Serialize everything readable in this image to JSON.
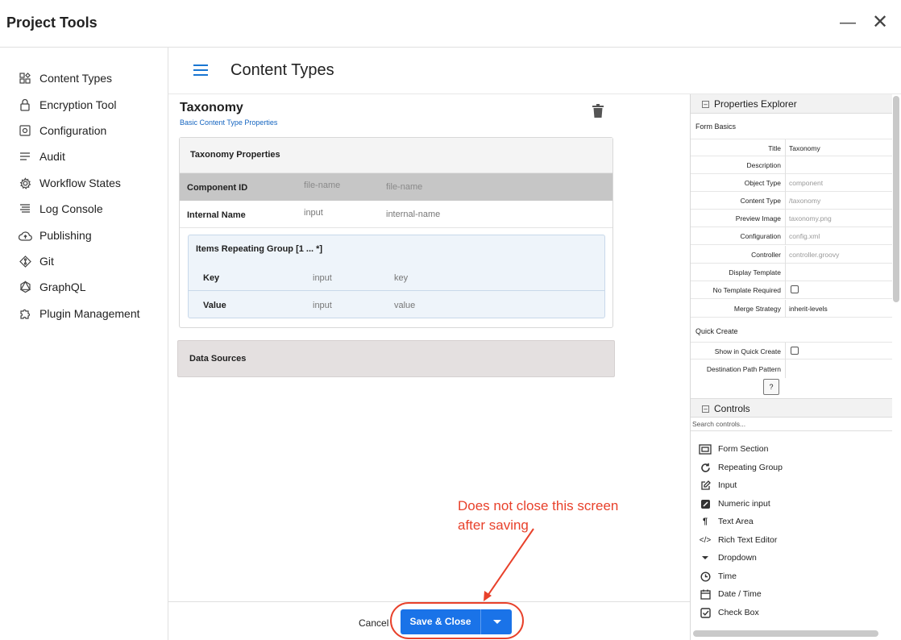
{
  "window": {
    "title": "Project Tools"
  },
  "sidebar": {
    "items": [
      {
        "label": "Content Types",
        "icon": "content-types-icon"
      },
      {
        "label": "Encryption Tool",
        "icon": "lock-icon"
      },
      {
        "label": "Configuration",
        "icon": "configuration-icon"
      },
      {
        "label": "Audit",
        "icon": "audit-icon"
      },
      {
        "label": "Workflow States",
        "icon": "gear-icon"
      },
      {
        "label": "Log Console",
        "icon": "log-icon"
      },
      {
        "label": "Publishing",
        "icon": "cloud-upload-icon"
      },
      {
        "label": "Git",
        "icon": "git-icon"
      },
      {
        "label": "GraphQL",
        "icon": "graphql-icon"
      },
      {
        "label": "Plugin Management",
        "icon": "puzzle-icon"
      }
    ]
  },
  "main": {
    "title": "Content Types"
  },
  "content_type": {
    "name": "Taxonomy",
    "subtitle": "Basic Content Type Properties",
    "section_title": "Taxonomy Properties",
    "fields": [
      {
        "label": "Component ID",
        "type": "file-name",
        "id": "file-name"
      },
      {
        "label": "Internal Name",
        "type": "input",
        "id": "internal-name"
      }
    ],
    "group": {
      "title": "Items Repeating Group [1 ... *]",
      "fields": [
        {
          "label": "Key",
          "type": "input",
          "id": "key"
        },
        {
          "label": "Value",
          "type": "input",
          "id": "value"
        }
      ]
    },
    "data_sources": "Data Sources"
  },
  "properties": {
    "header": "Properties Explorer",
    "form_basics": "Form Basics",
    "rows": [
      {
        "label": "Title",
        "value": "Taxonomy"
      },
      {
        "label": "Description",
        "value": ""
      },
      {
        "label": "Object Type",
        "value": "component",
        "placeholder": true
      },
      {
        "label": "Content Type",
        "value": "/taxonomy",
        "placeholder": true
      },
      {
        "label": "Preview Image",
        "value": "taxonomy.png",
        "placeholder": true
      },
      {
        "label": "Configuration",
        "value": "config.xml",
        "placeholder": true
      },
      {
        "label": "Controller",
        "value": "controller.groovy",
        "placeholder": true
      },
      {
        "label": "Display Template",
        "value": ""
      },
      {
        "label": "No Template Required",
        "checkbox": true
      },
      {
        "label": "Merge Strategy",
        "value": "inherit-levels"
      }
    ],
    "quick_create": "Quick Create",
    "quick_rows": [
      {
        "label": "Show in Quick Create",
        "checkbox": true
      },
      {
        "label": "Destination Path Pattern",
        "value": ""
      }
    ],
    "help": "?"
  },
  "controls": {
    "header": "Controls",
    "search_placeholder": "Search controls...",
    "items": [
      {
        "label": "Form Section",
        "icon": "form-section-icon"
      },
      {
        "label": "Repeating Group",
        "icon": "repeat-icon"
      },
      {
        "label": "Input",
        "icon": "edit-icon"
      },
      {
        "label": "Numeric input",
        "icon": "numeric-icon"
      },
      {
        "label": "Text Area",
        "icon": "paragraph-icon"
      },
      {
        "label": "Rich Text Editor",
        "icon": "code-icon"
      },
      {
        "label": "Dropdown",
        "icon": "caret-down-icon"
      },
      {
        "label": "Time",
        "icon": "clock-icon"
      },
      {
        "label": "Date / Time",
        "icon": "calendar-icon"
      },
      {
        "label": "Check Box",
        "icon": "checkbox-icon"
      }
    ]
  },
  "footer": {
    "cancel": "Cancel",
    "save": "Save & Close"
  },
  "annotation": {
    "line1": "Does not close this screen",
    "line2": "after saving",
    "color": "#e8412b"
  },
  "colors": {
    "accent": "#1a73e8",
    "link": "#1565c0"
  }
}
